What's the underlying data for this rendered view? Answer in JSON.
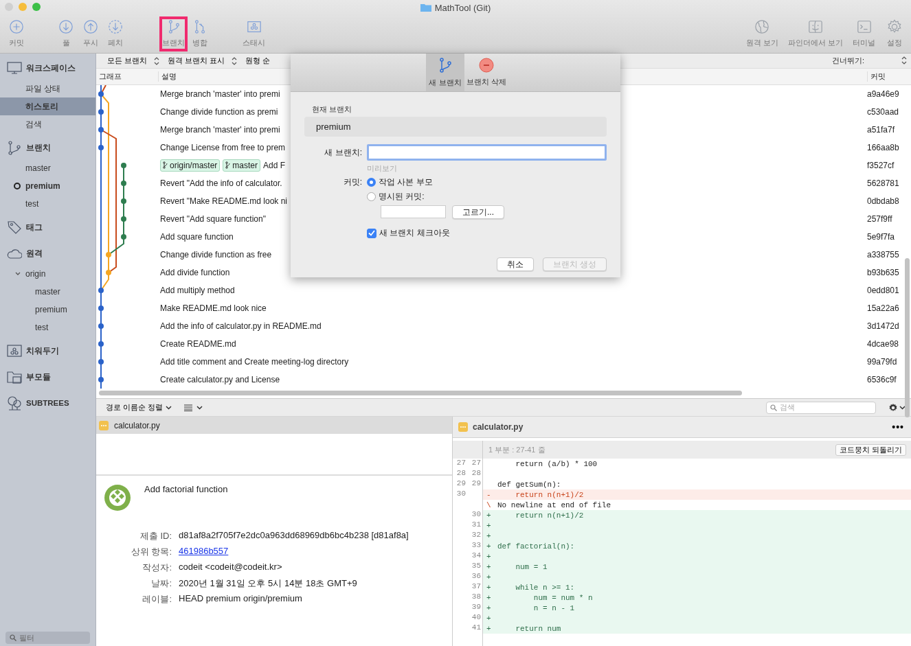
{
  "window": {
    "title": "MathTool (Git)"
  },
  "toolbar": {
    "left": [
      {
        "kind": "add",
        "label": "커밋",
        "highlighted": false
      },
      {
        "kind": "pull",
        "label": "풀",
        "highlighted": false
      },
      {
        "kind": "push",
        "label": "푸시",
        "highlighted": false
      },
      {
        "kind": "fetch",
        "label": "페치",
        "highlighted": false
      },
      {
        "kind": "branch",
        "label": "브랜치",
        "highlighted": true
      },
      {
        "kind": "merge",
        "label": "병합",
        "highlighted": false
      },
      {
        "kind": "stash",
        "label": "스태시",
        "highlighted": false
      }
    ],
    "right": [
      {
        "kind": "remote",
        "label": "원격 보기"
      },
      {
        "kind": "finder",
        "label": "파인더에서 보기"
      },
      {
        "kind": "terminal",
        "label": "터미널"
      },
      {
        "kind": "settings",
        "label": "설정"
      }
    ]
  },
  "sidebar": {
    "sections": [
      {
        "kind": "workspace",
        "label": "워크스페이스",
        "items": [
          {
            "label": "파일 상태",
            "selected": false
          },
          {
            "label": "히스토리",
            "selected": true
          },
          {
            "label": "검색",
            "selected": false
          }
        ]
      },
      {
        "kind": "branches",
        "label": "브랜치",
        "items": [
          {
            "label": "master",
            "selected": false,
            "current": false
          },
          {
            "label": "premium",
            "selected": false,
            "current": true
          },
          {
            "label": "test",
            "selected": false,
            "current": false
          }
        ]
      },
      {
        "kind": "tags",
        "label": "태그"
      },
      {
        "kind": "remotes",
        "label": "원격",
        "items": [
          {
            "label": "origin",
            "selected": false,
            "expanded": true,
            "children": [
              {
                "label": "master",
                "selected": false
              },
              {
                "label": "premium",
                "selected": false
              },
              {
                "label": "test",
                "selected": false
              }
            ]
          }
        ]
      },
      {
        "kind": "stashes",
        "label": "치워두기"
      },
      {
        "kind": "submodules",
        "label": "부모듈"
      },
      {
        "kind": "subtrees",
        "label": "SUBTREES"
      }
    ],
    "filter_placeholder": "필터"
  },
  "history": {
    "filters": [
      {
        "label": "모든 브랜치",
        "stepper": true
      },
      {
        "label": "원격 브랜치 표시",
        "stepper": true
      },
      {
        "label": "원형 순",
        "stepper": false
      }
    ],
    "jump_label": "건너뛰기:",
    "columns": [
      "그래프",
      "설명",
      "커밋"
    ],
    "commits": [
      {
        "description": "Merge branch 'master' into premi",
        "hash": "a9a46e9"
      },
      {
        "description": "Change divide function as premi",
        "hash": "c530aad"
      },
      {
        "description": "Merge branch 'master' into premi",
        "hash": "a51fa7f"
      },
      {
        "description": "Change License from free to prem",
        "hash": "166aa8b"
      },
      {
        "refs": [
          "origin/master",
          "master"
        ],
        "description": "Add F",
        "hash": "f3527cf"
      },
      {
        "description": "Revert \"Add the info of calculator.",
        "hash": "5628781"
      },
      {
        "description": "Revert \"Make README.md look ni",
        "hash": "0dbdab8"
      },
      {
        "description": "Revert \"Add square function\"",
        "hash": "257f9ff"
      },
      {
        "description": "Add square function",
        "hash": "5e9f7fa"
      },
      {
        "description": "Change divide function as free",
        "hash": "a338755"
      },
      {
        "description": "Add divide function",
        "hash": "b93b635"
      },
      {
        "description": "Add multiply method",
        "hash": "0edd801"
      },
      {
        "description": "Make README.md look nice",
        "hash": "15a22a6"
      },
      {
        "description": "Add the info of calculator.py in README.md",
        "hash": "3d1472d"
      },
      {
        "description": "Create README.md",
        "hash": "4dcae98"
      },
      {
        "description": "Add title comment and Create meeting-log directory",
        "hash": "99a79fd"
      },
      {
        "description": "Create calculator.py and License",
        "hash": "6536c9f"
      }
    ]
  },
  "dialog": {
    "tabs": [
      {
        "kind": "new",
        "label": "새 브랜치",
        "selected": true
      },
      {
        "kind": "delete",
        "label": "브랜치 삭제",
        "selected": false
      }
    ],
    "current_branch_label": "현재 브랜치",
    "current_branch": "premium",
    "new_branch_label": "새 브랜치:",
    "preview": "미리보기",
    "commit_label": "커밋:",
    "commit_options": [
      {
        "label": "작업 사본 부모",
        "selected": true
      },
      {
        "label": "명시된 커밋:",
        "selected": false
      }
    ],
    "pick_button": "고르기...",
    "checkout": {
      "label": "새 브랜치 체크아웃",
      "checked": true
    },
    "buttons": [
      {
        "label": "취소",
        "disabled": false
      },
      {
        "label": "브랜치 생성",
        "disabled": true
      }
    ]
  },
  "bottom": {
    "sort": "경로 이름순 정렬",
    "search_placeholder": "검색",
    "files": [
      {
        "name": "calculator.py",
        "selected": true
      }
    ],
    "commit": {
      "title": "Add factorial function",
      "fields": [
        {
          "label": "제출 ID:",
          "value": "d81af8a2f705f7e2dc0a963dd68969db6bc4b238 [d81af8a]",
          "kind": "text"
        },
        {
          "label": "상위 항목:",
          "value": "461986b557",
          "kind": "link"
        },
        {
          "label": "작성자:",
          "value": "codeit <codeit@codeit.kr>",
          "kind": "text"
        },
        {
          "label": "날짜:",
          "value": "2020년 1월 31일 오후 5시 14분 18초 GMT+9",
          "kind": "text"
        },
        {
          "label": "레이블:",
          "value": "HEAD premium origin/premium",
          "kind": "text"
        }
      ]
    },
    "diff": {
      "file": "calculator.py",
      "more": "•••",
      "hunk": "1 부분 : 27-41 줄",
      "revert": "코드뭉치 되돌리기",
      "lines": [
        {
          "kind": "context",
          "old": "27",
          "new": "27",
          "text": "    return (a/b) * 100"
        },
        {
          "kind": "context",
          "old": "28",
          "new": "28"
        },
        {
          "kind": "context",
          "old": "29",
          "new": "29",
          "text": "def getSum(n):"
        },
        {
          "kind": "removed",
          "old": "30",
          "marker": "-",
          "text": "    return n(n+1)/2"
        },
        {
          "kind": "note",
          "marker": "\\",
          "text": "No newline at end of file"
        },
        {
          "kind": "added",
          "new": "30",
          "marker": "+",
          "text": "    return n(n+1)/2"
        },
        {
          "kind": "added",
          "new": "31",
          "marker": "+"
        },
        {
          "kind": "added",
          "new": "32",
          "marker": "+"
        },
        {
          "kind": "added",
          "new": "33",
          "marker": "+",
          "text": "def factorial(n):"
        },
        {
          "kind": "added",
          "new": "34",
          "marker": "+"
        },
        {
          "kind": "added",
          "new": "35",
          "marker": "+",
          "text": "    num = 1"
        },
        {
          "kind": "added",
          "new": "36",
          "marker": "+"
        },
        {
          "kind": "added",
          "new": "37",
          "marker": "+",
          "text": "    while n >= 1:"
        },
        {
          "kind": "added",
          "new": "38",
          "marker": "+",
          "text": "        num = num * n"
        },
        {
          "kind": "added",
          "new": "39",
          "marker": "+",
          "text": "        n = n - 1"
        },
        {
          "kind": "added",
          "new": "40",
          "marker": "+"
        },
        {
          "kind": "added",
          "new": "41",
          "marker": "+",
          "text": "    return num"
        }
      ]
    }
  }
}
